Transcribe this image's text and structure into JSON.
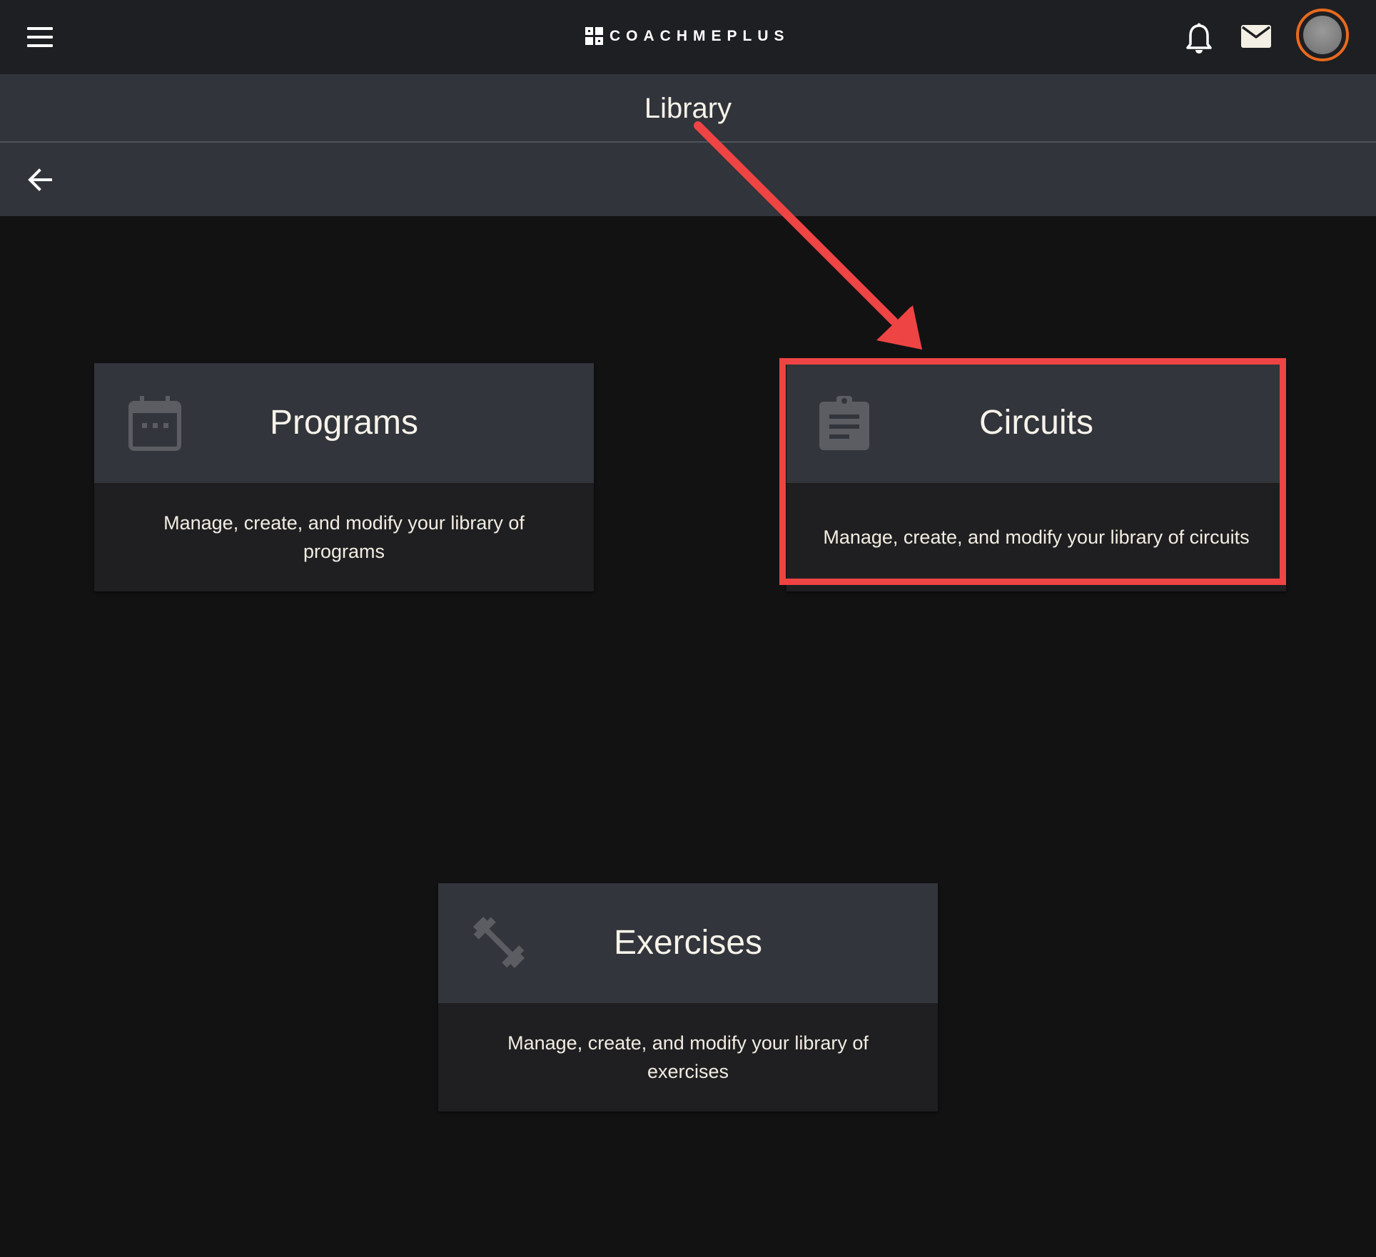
{
  "header": {
    "brand": "COACHMEPLUS",
    "menu_icon": "hamburger-menu-icon",
    "notifications_icon": "bell-icon",
    "messages_icon": "mail-icon",
    "accent_color": "#e86a1e"
  },
  "page": {
    "title": "Library",
    "back_icon": "arrow-left-icon"
  },
  "cards": [
    {
      "title": "Programs",
      "description": "Manage, create, and modify your library of programs",
      "icon": "calendar-icon"
    },
    {
      "title": "Circuits",
      "description": "Manage, create, and modify your library of circuits",
      "icon": "clipboard-icon"
    },
    {
      "title": "Exercises",
      "description": "Manage, create, and modify your library of exercises",
      "icon": "dumbbell-icon"
    }
  ],
  "annotation": {
    "highlight_color": "#ee4444",
    "target": "Circuits"
  }
}
